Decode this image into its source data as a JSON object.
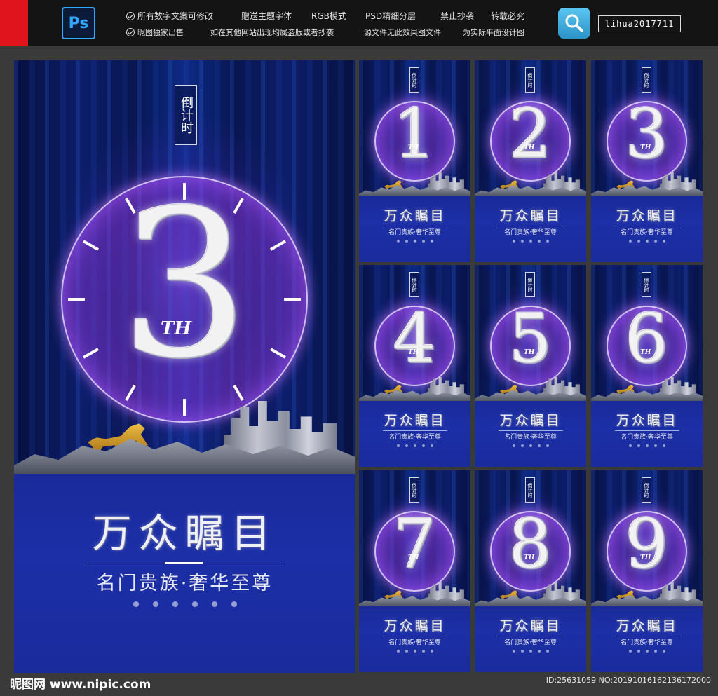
{
  "header": {
    "ps_label": "Ps",
    "features_row1": [
      "所有数字文案可修改",
      "赠送主题字体",
      "RGB模式",
      "PSD精细分层",
      "禁止抄袭",
      "转载必究"
    ],
    "features_row2": [
      "昵图独家出售",
      "如在其他网站出现均属盗版或者抄袭",
      "源文件无此效果图文件",
      "为实际平面设计图"
    ],
    "user": "lihua2017711"
  },
  "main_poster": {
    "tag": "倒计时",
    "number": "3",
    "th": "TH",
    "headline": "万众瞩目",
    "sub": "名门贵族·奢华至尊"
  },
  "thumbs": [
    {
      "number": "1",
      "th": "TH",
      "tag": "倒计时",
      "headline": "万众瞩目",
      "sub": "名门贵族·奢华至尊"
    },
    {
      "number": "2",
      "th": "TH",
      "tag": "倒计时",
      "headline": "万众瞩目",
      "sub": "名门贵族·奢华至尊"
    },
    {
      "number": "3",
      "th": "TH",
      "tag": "倒计时",
      "headline": "万众瞩目",
      "sub": "名门贵族·奢华至尊"
    },
    {
      "number": "4",
      "th": "TH",
      "tag": "倒计时",
      "headline": "万众瞩目",
      "sub": "名门贵族·奢华至尊"
    },
    {
      "number": "5",
      "th": "TH",
      "tag": "倒计时",
      "headline": "万众瞩目",
      "sub": "名门贵族·奢华至尊"
    },
    {
      "number": "6",
      "th": "TH",
      "tag": "倒计时",
      "headline": "万众瞩目",
      "sub": "名门贵族·奢华至尊"
    },
    {
      "number": "7",
      "th": "TH",
      "tag": "倒计时",
      "headline": "万众瞩目",
      "sub": "名门贵族·奢华至尊"
    },
    {
      "number": "8",
      "th": "TH",
      "tag": "倒计时",
      "headline": "万众瞩目",
      "sub": "名门贵族·奢华至尊"
    },
    {
      "number": "9",
      "th": "TH",
      "tag": "倒计时",
      "headline": "万众瞩目",
      "sub": "名门贵族·奢华至尊"
    }
  ],
  "footer": {
    "logo": "昵图网 www.nipic.com",
    "id": "ID:25631059 NO:20191016162136172000"
  },
  "colors": {
    "brand_red": "#e0141c",
    "ps_blue": "#31a8ff",
    "poster_navy": "#1a2a9a",
    "glow_purple": "#a050ff"
  }
}
